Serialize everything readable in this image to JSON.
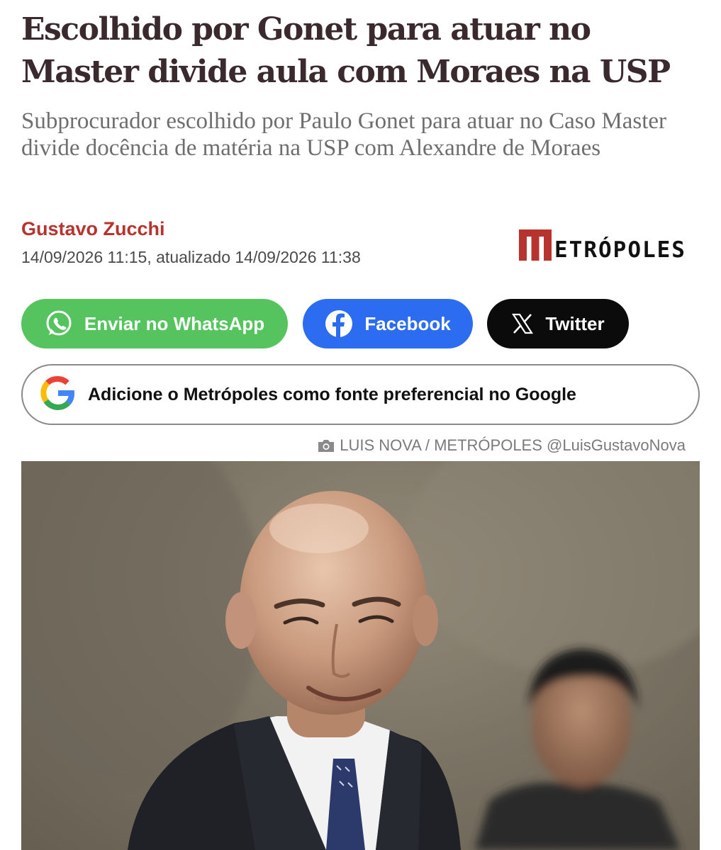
{
  "article": {
    "headline": "Escolhido por Gonet para atuar no Master divide aula com Moraes na USP",
    "subheadline": "Subprocurador escolhido por Paulo Gonet para atuar no Caso Master divide docência de matéria na USP com Alexandre de Moraes",
    "author": "Gustavo Zucchi",
    "dateline": "14/09/2026 11:15, atualizado 14/09/2026 11:38"
  },
  "brand": {
    "name": "ETRÓPOLES",
    "accent": "#b8322e",
    "icon": "metropoles-m-logo"
  },
  "share": {
    "whatsapp_label": "Enviar no WhatsApp",
    "facebook_label": "Facebook",
    "twitter_label": "Twitter",
    "colors": {
      "whatsapp": "#55c45e",
      "facebook": "#2c6cf0",
      "twitter": "#0b0b0b"
    }
  },
  "google_source": {
    "label": "Adicione o Metrópoles como fonte preferencial no Google",
    "icon": "google-g-icon"
  },
  "photo": {
    "credit": "LUIS NOVA / METRÓPOLES @LuisGustavoNova",
    "credit_icon": "camera-icon"
  }
}
